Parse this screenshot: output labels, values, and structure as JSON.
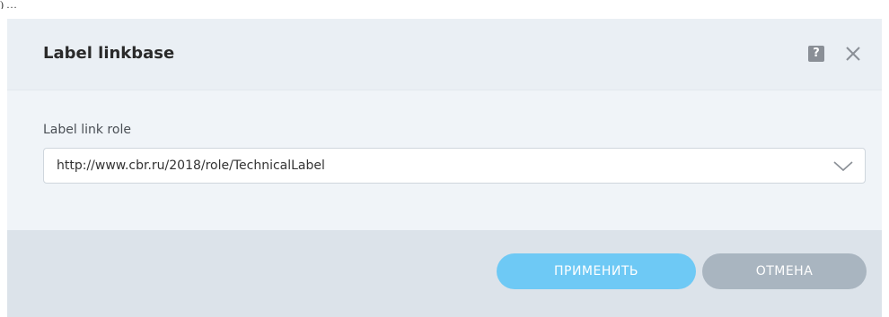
{
  "artifact": {
    "text": ") …"
  },
  "dialog": {
    "title": "Label linkbase",
    "help_symbol": "?",
    "icons": {
      "help": "help-icon",
      "close": "close-icon",
      "dropdown": "chevron-down-icon"
    },
    "field": {
      "label": "Label link role",
      "value": "http://www.cbr.ru/2018/role/TechnicalLabel"
    },
    "buttons": {
      "apply_label": "ПРИМЕНИТЬ",
      "cancel_label": "ОТМЕНА"
    },
    "colors": {
      "apply": "#6ec9f5",
      "cancel": "#a9b5c0",
      "header": "#eaeff4",
      "footer": "#dce3ea"
    }
  }
}
